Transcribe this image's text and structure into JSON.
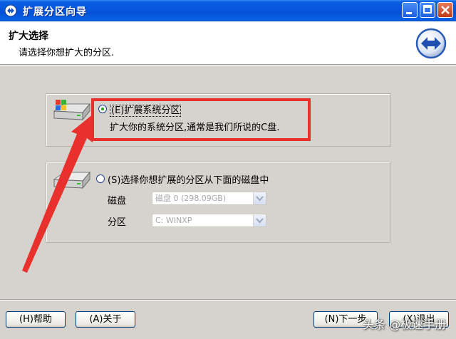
{
  "window": {
    "title": "扩展分区向导"
  },
  "header": {
    "title": "扩大选择",
    "subtitle": "请选择你想扩大的分区."
  },
  "options": [
    {
      "label": "(E)扩展系统分区",
      "description": "扩大你的系统分区,通常是我们所说的C盘.",
      "selected": true
    },
    {
      "label": "(S)选择你想扩展的分区从下面的磁盘中",
      "selected": false,
      "fields": {
        "disk_label": "磁盘",
        "disk_value": "磁盘 0 (298.09GB)",
        "partition_label": "分区",
        "partition_value": "C: WINXP"
      }
    }
  ],
  "buttons": {
    "help": "(H)帮助",
    "about": "(A)关于",
    "next": "(N)下一步",
    "exit": "(X)退出"
  },
  "watermark": "头条 @极速手册",
  "colors": {
    "annotation_red": "#e8312c",
    "titlebar_blue": "#0656de"
  }
}
